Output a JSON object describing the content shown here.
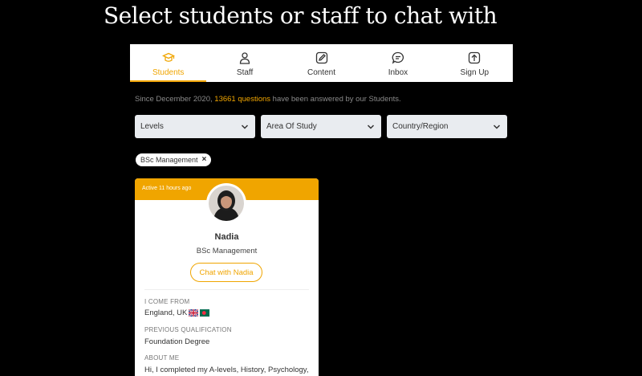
{
  "page": {
    "title": "Select students or staff to chat with"
  },
  "tabs": [
    {
      "label": "Students",
      "icon": "graduation-cap-icon",
      "active": true
    },
    {
      "label": "Staff",
      "icon": "user-icon",
      "active": false
    },
    {
      "label": "Content",
      "icon": "edit-icon",
      "active": false
    },
    {
      "label": "Inbox",
      "icon": "chat-bubble-icon",
      "active": false
    },
    {
      "label": "Sign Up",
      "icon": "upload-icon",
      "active": false
    }
  ],
  "stats": {
    "prefix": "Since December 2020, ",
    "highlight": "13661 questions",
    "suffix": " have been answered by our Students."
  },
  "filters": {
    "levels": "Levels",
    "area": "Area Of Study",
    "country": "Country/Region"
  },
  "active_filter": {
    "label": "BSc Management",
    "remove": "×"
  },
  "card": {
    "active": "Active 11 hours ago",
    "name": "Nadia",
    "course": "BSc Management",
    "chat_button": "Chat with Nadia",
    "come_from_label": "I COME FROM",
    "come_from_value": "England, UK",
    "qualification_label": "PREVIOUS QUALIFICATION",
    "qualification_value": "Foundation Degree",
    "about_label": "ABOUT ME",
    "about_value": "Hi, I completed my A-levels, History, Psychology,"
  },
  "colors": {
    "accent": "#f0a500",
    "background": "#000000",
    "select_bg": "#e9ecf0"
  }
}
